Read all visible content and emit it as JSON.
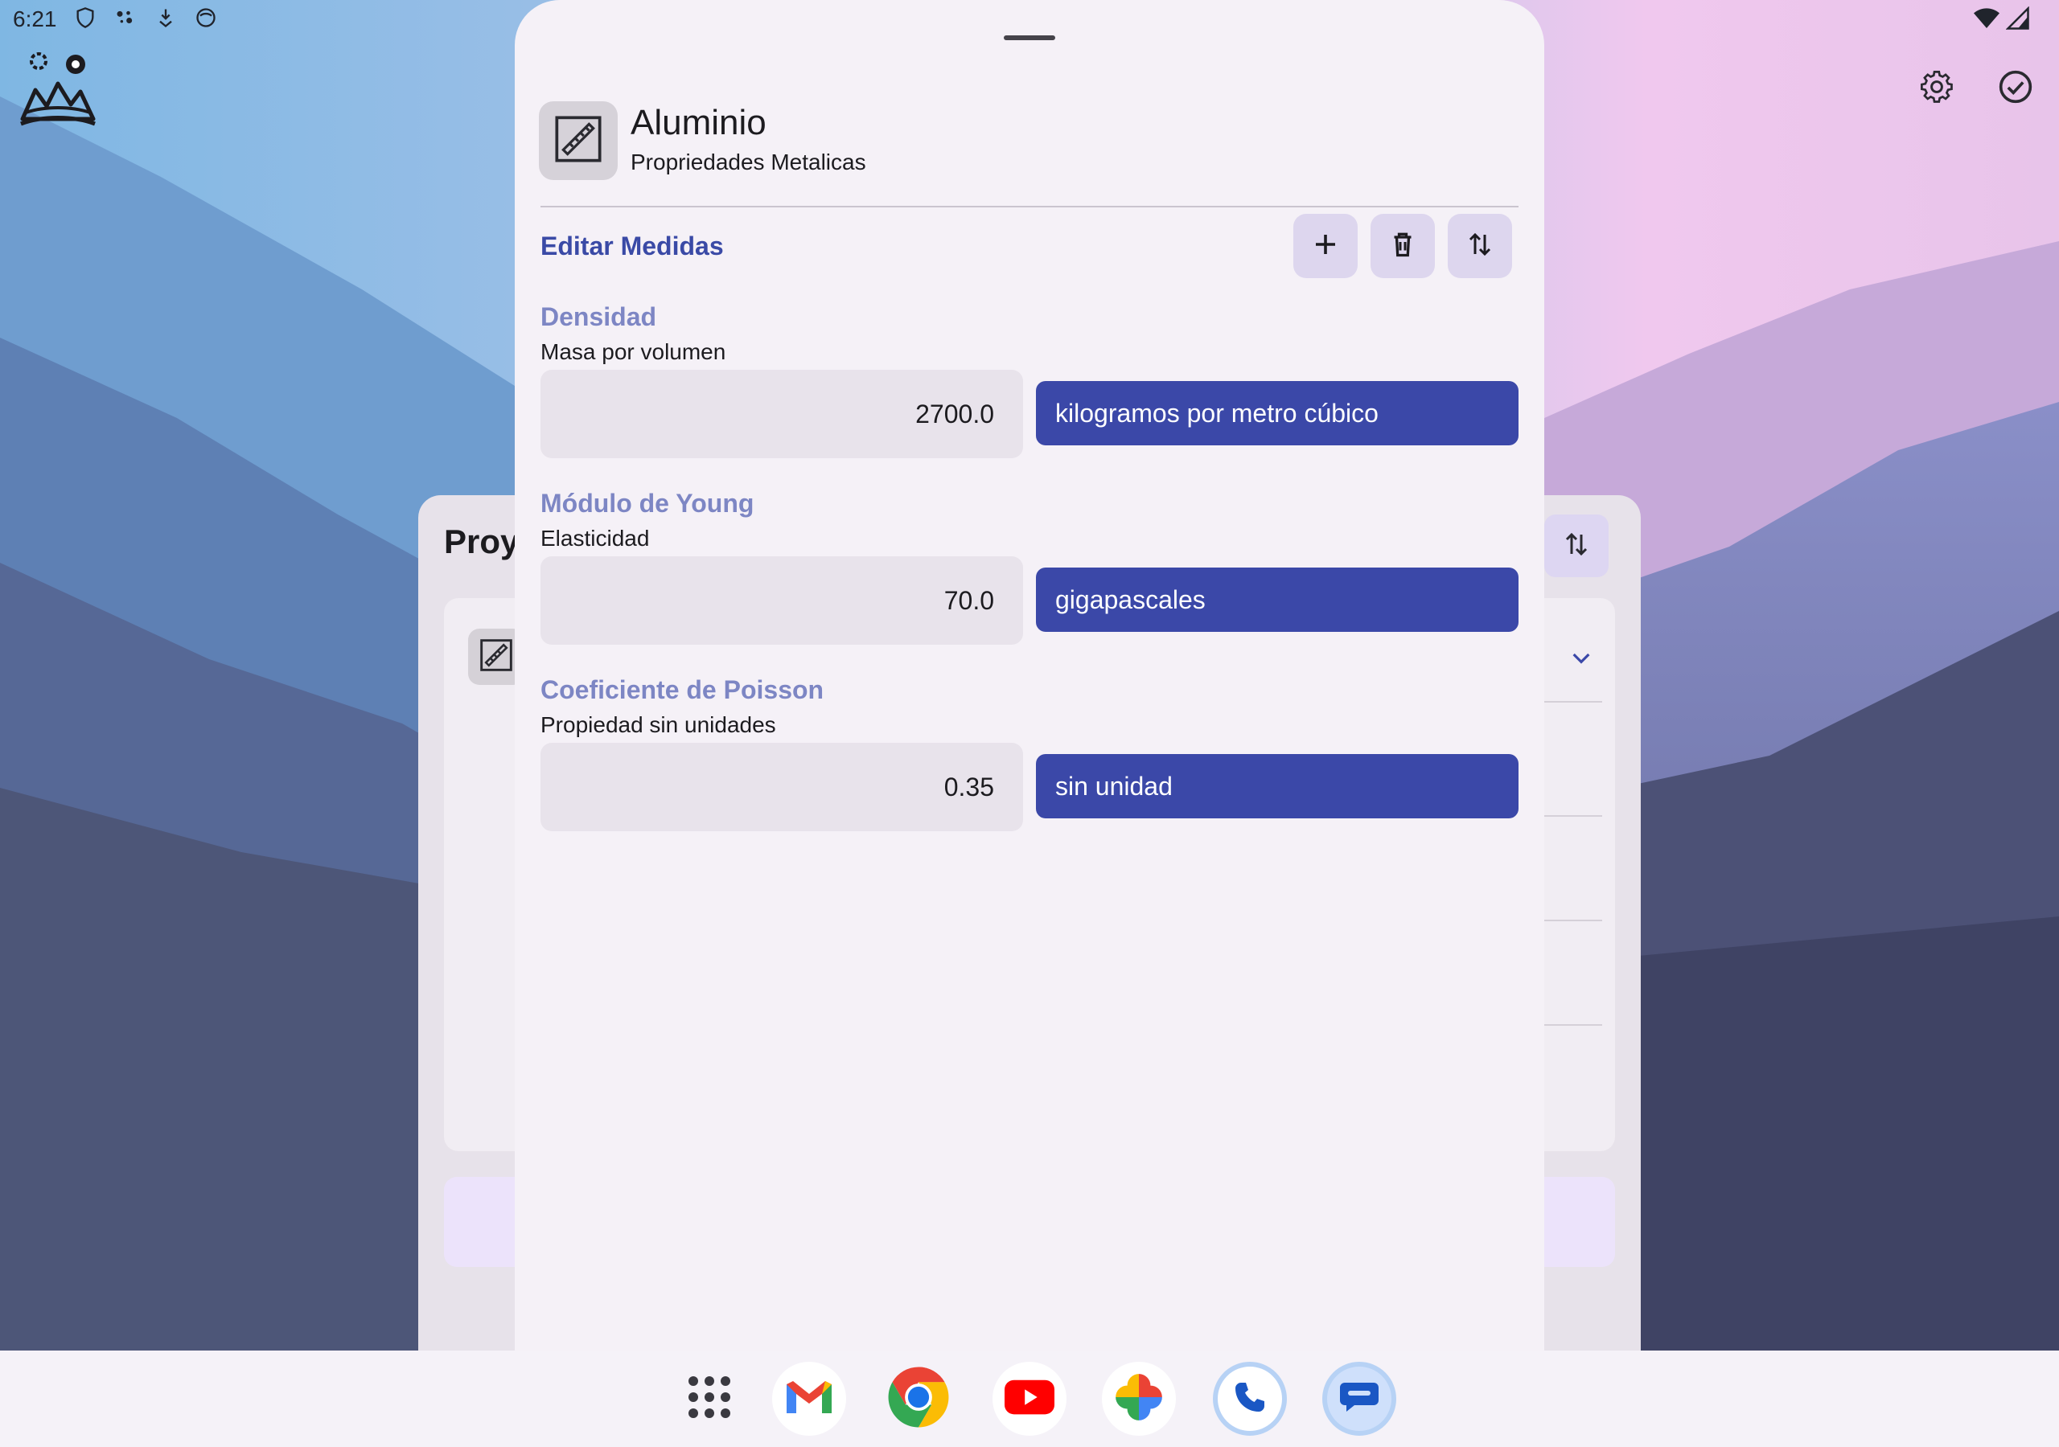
{
  "status_bar": {
    "time": "6:21",
    "left_icons": [
      "shield-icon",
      "assistant-dots-icon",
      "download-icon",
      "face-icon"
    ],
    "right_icons": [
      "wifi-icon",
      "signal-icon"
    ]
  },
  "top_actions": [
    "settings-icon",
    "check-circle-icon"
  ],
  "background_screen": {
    "title_partial": "Proy"
  },
  "sheet": {
    "title": "Aluminio",
    "subtitle": "Propriedades Metalicas",
    "section_title": "Editar Medidas",
    "tools": [
      "add-icon",
      "delete-icon",
      "sort-icon"
    ],
    "properties": [
      {
        "name": "Densidad",
        "description": "Masa por volumen",
        "value": "2700.0",
        "unit": "kilogramos por metro cúbico"
      },
      {
        "name": "Módulo de Young",
        "description": "Elasticidad",
        "value": "70.0",
        "unit": "gigapascales"
      },
      {
        "name": "Coeficiente de Poisson",
        "description": "Propiedad sin unidades",
        "value": "0.35",
        "unit": "sin unidad"
      }
    ]
  },
  "dock": {
    "apps": [
      "app-drawer-icon",
      "gmail-icon",
      "chrome-icon",
      "youtube-icon",
      "photos-icon",
      "phone-icon",
      "messages-icon"
    ]
  },
  "colors": {
    "accent": "#3b48a8",
    "prop_name": "#7d86c4",
    "sheet_bg": "#f5f1f7"
  }
}
